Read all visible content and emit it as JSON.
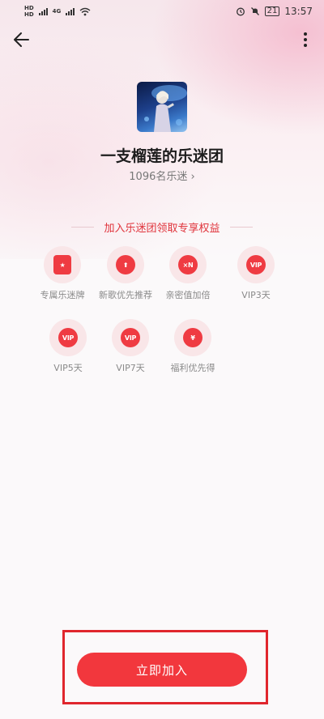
{
  "status_bar": {
    "left_indicators": [
      "HD",
      "HD"
    ],
    "network": "4G",
    "battery": "21",
    "time": "13:57"
  },
  "nav": {
    "back_icon": "arrow-left-icon",
    "more_icon": "more-vertical-icon"
  },
  "group": {
    "name": "一支榴莲的乐迷团",
    "fans": "1096名乐迷",
    "fans_chevron": "›"
  },
  "benefits_section": {
    "title": "加入乐迷团领取专享权益",
    "items": [
      {
        "label": "专属乐迷牌",
        "icon": "fan-badge-icon",
        "glyph": "★"
      },
      {
        "label": "新歌优先推荐",
        "icon": "arrow-up-icon",
        "glyph": "⬆"
      },
      {
        "label": "亲密值加倍",
        "icon": "multiply-icon",
        "glyph": "×N"
      },
      {
        "label": "VIP3天",
        "icon": "vip-icon",
        "glyph": "VIP"
      },
      {
        "label": "VIP5天",
        "icon": "vip-icon",
        "glyph": "VIP"
      },
      {
        "label": "VIP7天",
        "icon": "vip-icon",
        "glyph": "VIP"
      },
      {
        "label": "福利优先得",
        "icon": "money-bag-icon",
        "glyph": "¥"
      }
    ]
  },
  "cta": {
    "join_label": "立即加入"
  },
  "colors": {
    "accent": "#f2373d",
    "highlight": "#e0262d",
    "icon_bg": "#f9e6e8"
  }
}
